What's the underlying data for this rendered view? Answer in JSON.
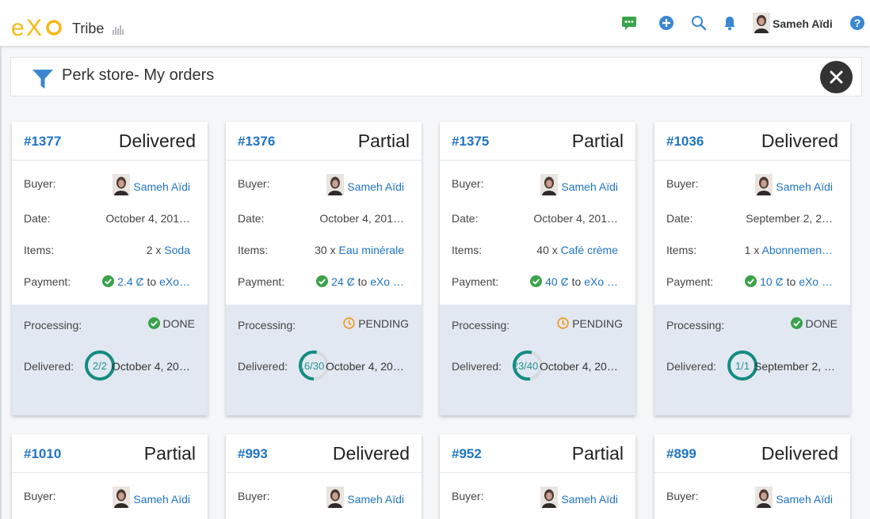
{
  "brand": {
    "logo_text": "eXo",
    "site_name": "Tribe"
  },
  "topbar": {
    "icons": [
      "chat-icon",
      "plus-circle-icon",
      "search-icon",
      "bell-icon"
    ],
    "user_name": "Sameh Aïdi",
    "help_icon": "help-icon"
  },
  "colors": {
    "accent": "#1f74c4",
    "done": "#3aa24a",
    "pending": "#f29a1a",
    "ring": "#138c82",
    "ring_track": "#d8dadd",
    "panel": "#e1e8f2"
  },
  "filter": {
    "title": "Perk store- My orders"
  },
  "labels": {
    "buyer": "Buyer:",
    "date": "Date:",
    "items": "Items:",
    "payment": "Payment:",
    "processing": "Processing:",
    "delivered": "Delivered:"
  },
  "orders": [
    {
      "id": "#1377",
      "status": "Delivered",
      "buyer": "Sameh Aïdi",
      "date": "October 4, 201…",
      "items_qty": "2 x",
      "items_name": "Soda",
      "payment_amount": "2.4 Ȼ",
      "payment_to": "to",
      "payment_target": "eXo…",
      "processing": "DONE",
      "processing_state": "done",
      "delivered_label": "2/2",
      "delivered_fraction": 1.0,
      "delivered_date": "October 4, 20…"
    },
    {
      "id": "#1376",
      "status": "Partial",
      "buyer": "Sameh Aïdi",
      "date": "October 4, 201…",
      "items_qty": "30 x",
      "items_name": "Eau minérale",
      "payment_amount": "24 Ȼ",
      "payment_to": "to",
      "payment_target": "eXo …",
      "processing": "PENDING",
      "processing_state": "pending",
      "delivered_label": "16/30",
      "delivered_fraction": 0.5333,
      "delivered_date": "October 4, 20…"
    },
    {
      "id": "#1375",
      "status": "Partial",
      "buyer": "Sameh Aïdi",
      "date": "October 4, 201…",
      "items_qty": "40 x",
      "items_name": "Café crème",
      "payment_amount": "40 Ȼ",
      "payment_to": "to",
      "payment_target": "eXo …",
      "processing": "PENDING",
      "processing_state": "pending",
      "delivered_label": "23/40",
      "delivered_fraction": 0.575,
      "delivered_date": "October 4, 20…"
    },
    {
      "id": "#1036",
      "status": "Delivered",
      "buyer": "Sameh Aïdi",
      "date": "September 2, 2…",
      "items_qty": "1 x",
      "items_name": "Abonnemen…",
      "payment_amount": "10 Ȼ",
      "payment_to": "to",
      "payment_target": "eXo …",
      "processing": "DONE",
      "processing_state": "done",
      "delivered_label": "1/1",
      "delivered_fraction": 1.0,
      "delivered_date": "September 2, …"
    },
    {
      "id": "#1010",
      "status": "Partial",
      "buyer": "Sameh Aïdi"
    },
    {
      "id": "#993",
      "status": "Delivered",
      "buyer": "Sameh Aïdi"
    },
    {
      "id": "#952",
      "status": "Partial",
      "buyer": "Sameh Aïdi"
    },
    {
      "id": "#899",
      "status": "Delivered",
      "buyer": "Sameh Aïdi"
    }
  ]
}
